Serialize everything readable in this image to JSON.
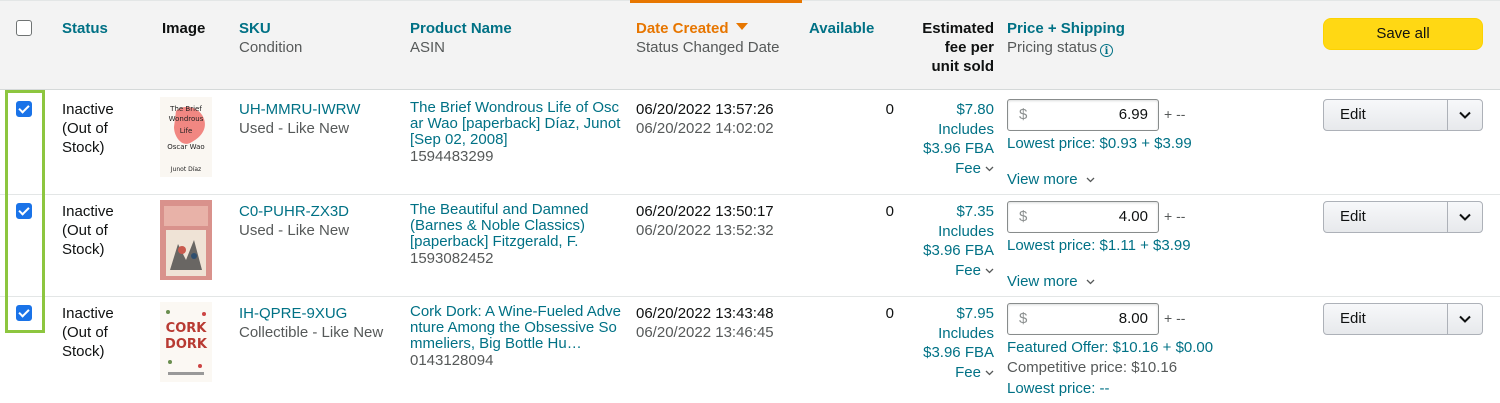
{
  "header": {
    "status": "Status",
    "image": "Image",
    "sku": "SKU",
    "sku_sub": "Condition",
    "product_name": "Product Name",
    "product_sub": "ASIN",
    "date_created": "Date Created",
    "date_sub": "Status Changed Date",
    "available": "Available",
    "fee_line1": "Estimated",
    "fee_line2": "fee per",
    "fee_line3": "unit sold",
    "price": "Price + Shipping",
    "price_sub": "Pricing status",
    "save_all": "Save all"
  },
  "colors": {
    "accent_blue": "#007185",
    "sort_orange": "#e77600",
    "save_yellow": "#ffd814",
    "highlight_green": "#8dc63f",
    "checkbox_blue": "#1a73e8"
  },
  "rows": [
    {
      "checked": true,
      "status1": "Inactive",
      "status2": "(Out of",
      "status3": "Stock)",
      "sku": "UH-MMRU-IWRW",
      "condition": "Used - Like New",
      "product": "The Brief Wondrous Life of Oscar Wao [paperback] Díaz, Junot [Sep 02, 2008]",
      "asin": "1594483299",
      "date_created": "06/20/2022 13:57:26",
      "status_changed": "06/20/2022 14:02:02",
      "available": "0",
      "fee_amount": "$7.80",
      "fee_includes": "Includes",
      "fee_fba": "$3.96 FBA",
      "fee_word": "Fee",
      "price_currency": "$",
      "price": "6.99",
      "shipping": "+ --",
      "price_line1": "Lowest price: $0.93 + $3.99",
      "view_more": "View more",
      "edit": "Edit",
      "thumb_title": [
        "The Brief",
        "Wondrous",
        "Life",
        "Oscar Wao",
        "Junot Díaz"
      ]
    },
    {
      "checked": true,
      "status1": "Inactive",
      "status2": "(Out of",
      "status3": "Stock)",
      "sku": "C0-PUHR-ZX3D",
      "condition": "Used - Like New",
      "product": "The Beautiful and Damned (Barnes & Noble Classics) [paperback] Fitzgerald, F. Scott,…",
      "asin": "1593082452",
      "date_created": "06/20/2022 13:50:17",
      "status_changed": "06/20/2022 13:52:32",
      "available": "0",
      "fee_amount": "$7.35",
      "fee_includes": "Includes",
      "fee_fba": "$3.96 FBA",
      "fee_word": "Fee",
      "price_currency": "$",
      "price": "4.00",
      "shipping": "+ --",
      "price_line1": "Lowest price: $1.11 + $3.99",
      "view_more": "View more",
      "edit": "Edit"
    },
    {
      "checked": true,
      "status1": "Inactive",
      "status2": "(Out of",
      "status3": "Stock)",
      "sku": "IH-QPRE-9XUG",
      "condition": "Collectible - Like New",
      "product": "Cork Dork: A Wine-Fueled Adventure Among the Obsessive Sommeliers, Big Bottle Hu…",
      "asin": "0143128094",
      "date_created": "06/20/2022 13:43:48",
      "status_changed": "06/20/2022 13:46:45",
      "available": "0",
      "fee_amount": "$7.95",
      "fee_includes": "Includes",
      "fee_fba": "$3.96 FBA",
      "fee_word": "Fee",
      "price_currency": "$",
      "price": "8.00",
      "shipping": "+ --",
      "price_line1": "Featured Offer: $10.16 + $0.00",
      "price_line2": "Competitive price: $10.16",
      "price_line3": "Lowest price: --",
      "edit": "Edit",
      "thumb_title": [
        "CORK",
        "DORK"
      ]
    }
  ]
}
